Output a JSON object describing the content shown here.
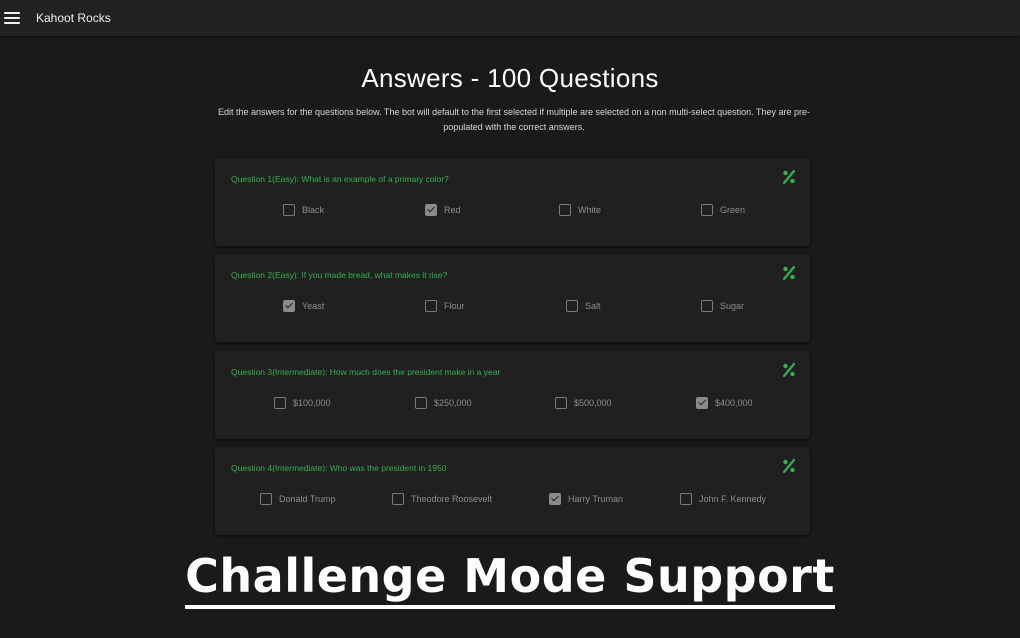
{
  "appbar": {
    "title": "Kahoot Rocks"
  },
  "page": {
    "title": "Answers - 100 Questions",
    "description": "Edit the answers for the questions below. The bot will default to the first selected if multiple are selected on a non multi-select question. They are pre-populated with the correct answers."
  },
  "icons": {
    "menu": "hamburger-menu-icon",
    "percent": "percent-icon"
  },
  "colors": {
    "background": "#1a1a1a",
    "card": "#202020",
    "question_text": "#2fb34a",
    "accent": "#2fb34a"
  },
  "questions": [
    {
      "text": "Question 1(Easy): What is an example of a primary color?",
      "options": [
        {
          "label": "Black",
          "checked": false
        },
        {
          "label": "Red",
          "checked": true
        },
        {
          "label": "White",
          "checked": false
        },
        {
          "label": "Green",
          "checked": false
        }
      ]
    },
    {
      "text": "Question 2(Easy): If you made bread, what makes it rise?",
      "options": [
        {
          "label": "Yeast",
          "checked": true
        },
        {
          "label": "Flour",
          "checked": false
        },
        {
          "label": "Salt",
          "checked": false
        },
        {
          "label": "Sugar",
          "checked": false
        }
      ]
    },
    {
      "text": "Question 3(Intermediate): How much does the president make in a year",
      "options": [
        {
          "label": "$100,000",
          "checked": false
        },
        {
          "label": "$250,000",
          "checked": false
        },
        {
          "label": "$500,000",
          "checked": false
        },
        {
          "label": "$400,000",
          "checked": true
        }
      ]
    },
    {
      "text": "Question 4(Intermediate): Who was the president in 1950",
      "options": [
        {
          "label": "Donald Trump",
          "checked": false
        },
        {
          "label": "Theodore Roosevelt",
          "checked": false
        },
        {
          "label": "Harry Truman",
          "checked": true
        },
        {
          "label": "John F. Kennedy",
          "checked": false
        }
      ]
    }
  ],
  "banner": {
    "text": "Challenge Mode Support"
  }
}
